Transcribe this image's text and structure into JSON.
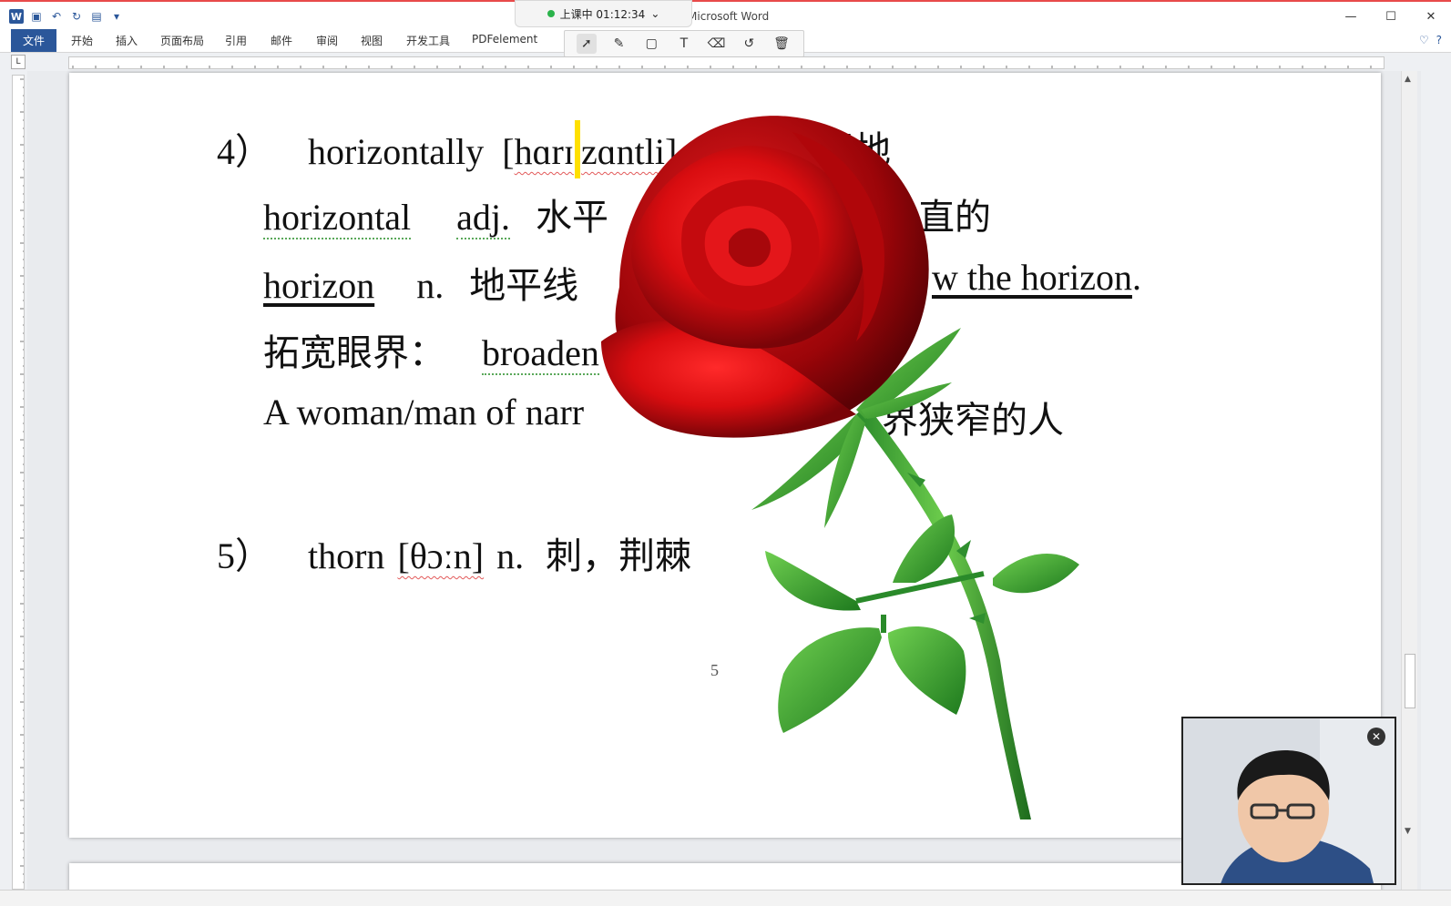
{
  "window": {
    "title": "Microsoft Word",
    "controls": [
      "—",
      "☐",
      "✕"
    ]
  },
  "class_status": {
    "label": "上课中 01:12:34",
    "color": "#2bb34b"
  },
  "ribbon": {
    "tabs": [
      "文件",
      "开始",
      "插入",
      "页面布局",
      "引用",
      "邮件",
      "审阅",
      "视图",
      "开发工具",
      "PDFelement"
    ],
    "accent": "#2b579a"
  },
  "annotation_tools": [
    "pointer-icon",
    "pen-icon",
    "rectangle-icon",
    "text-icon",
    "eraser-icon",
    "undo-icon",
    "trash-icon"
  ],
  "document": {
    "line1": {
      "num": "4）",
      "word": "horizontally",
      "ipa_open": "[",
      "ipa_a": "hɑrɪ",
      "ipa_b": "zɑntli]",
      "meaning": "水平地"
    },
    "line2": {
      "word": "horizontal",
      "pos": "adj.",
      "meaning_a": "水平",
      "meaning_b": "垂直的"
    },
    "line3": {
      "word": "horizon",
      "pos": "n.",
      "meaning": "地平线",
      "example_tail": "w the horizon",
      "period": "."
    },
    "line4": {
      "label": "拓宽眼界：",
      "phrase": "broaden"
    },
    "line5": {
      "text_a": "A woman/man of narr",
      "text_b": "界狭窄的人"
    },
    "line6": {
      "num": "5）",
      "word": "thorn",
      "ipa": "[θɔːn]",
      "pos": "n.",
      "meaning": "刺，荆棘"
    },
    "page_number": "5"
  },
  "webcam": {
    "close_icon": "close-icon"
  }
}
